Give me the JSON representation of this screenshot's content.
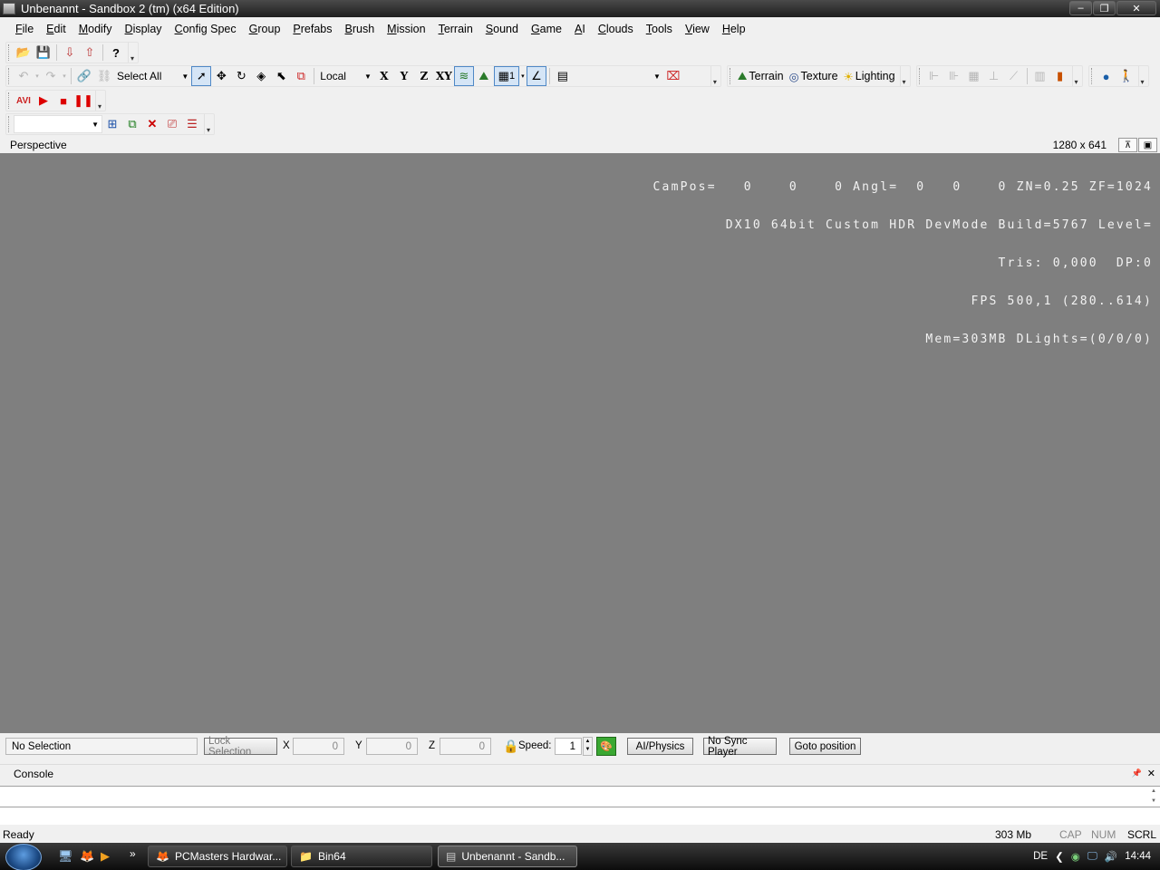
{
  "window": {
    "title": "Unbenannt - Sandbox 2 (tm) (x64 Edition)",
    "controls": {
      "minimize": "‒",
      "maximize": "❐",
      "close": "✕"
    }
  },
  "menu": [
    "File",
    "Edit",
    "Modify",
    "Display",
    "Config Spec",
    "Group",
    "Prefabs",
    "Brush",
    "Mission",
    "Terrain",
    "Sound",
    "Game",
    "AI",
    "Clouds",
    "Tools",
    "View",
    "Help"
  ],
  "toolbar": {
    "select_mode": "Select All",
    "coord_system": "Local",
    "axes": [
      "X",
      "Y",
      "Z",
      "XY"
    ],
    "grid_value": "1",
    "layer_combo": "",
    "terrain_label": "Terrain",
    "texture_label": "Texture",
    "lighting_label": "Lighting",
    "avi_label": "AVI",
    "object_combo": ""
  },
  "viewport": {
    "title": "Perspective",
    "resolution": "1280 x 641",
    "background": "#7f7f7f",
    "hud_lines": [
      "CamPos=   0    0    0 Angl=  0   0    0 ZN=0.25 ZF=1024",
      "DX10 64bit Custom HDR DevMode Build=5767 Level=",
      "Tris: 0,000  DP:0",
      "FPS 500,1 (280..614)",
      "Mem=303MB DLights=(0/0/0)"
    ]
  },
  "controls": {
    "selection": "No Selection",
    "lock_selection": "Lock Selection",
    "x_label": "X",
    "x_value": "0",
    "y_label": "Y",
    "y_value": "0",
    "z_label": "Z",
    "z_value": "0",
    "speed_label": "Speed:",
    "speed_value": "1",
    "ai_physics": "AI/Physics",
    "no_sync_player": "No Sync Player",
    "goto_position": "Goto position"
  },
  "console": {
    "title": "Console",
    "pin": "📌",
    "close": "✕"
  },
  "status": {
    "text": "Ready",
    "memory": "303 Mb",
    "cap": "CAP",
    "num": "NUM",
    "scrl": "SCRL"
  },
  "taskbar": {
    "tasks": [
      {
        "label": "PCMasters Hardwar..."
      },
      {
        "label": "Bin64"
      },
      {
        "label": "Unbenannt - Sandb..."
      }
    ],
    "lang": "DE",
    "clock": "14:44",
    "overflow": "»"
  }
}
